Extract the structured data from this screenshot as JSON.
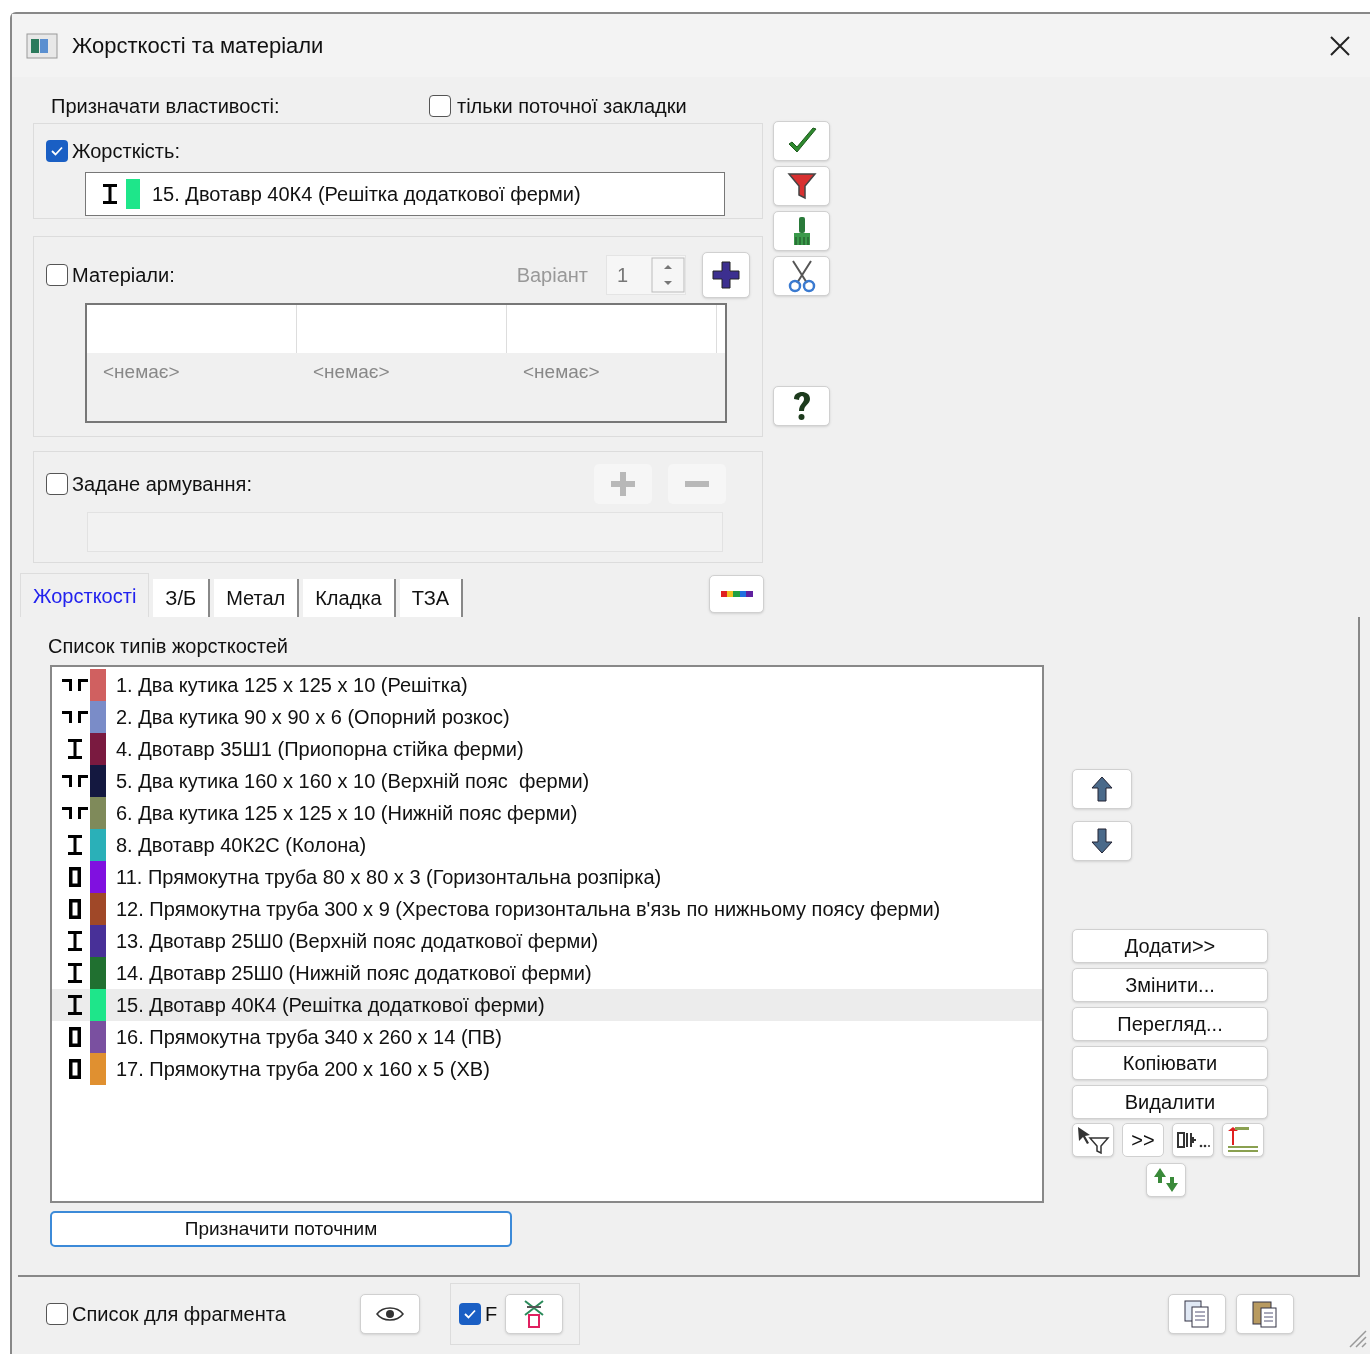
{
  "window": {
    "title": "Жорсткості та матеріали"
  },
  "assign": {
    "label": "Призначати властивості:",
    "current_tab_only": {
      "label": "тільки поточної закладки",
      "checked": false
    }
  },
  "stiffness": {
    "label": "Жорсткість:",
    "checked": true,
    "value": {
      "kind": "ibeam",
      "color": "#1ee68a",
      "text": "15. Двотавр 40К4 (Решітка додаткової ферми)"
    }
  },
  "materials": {
    "label": "Матеріали:",
    "checked": false,
    "variant_label": "Варіант",
    "variant": "1",
    "columns": [
      "<немає>",
      "<немає>",
      "<немає>"
    ]
  },
  "reinforcement": {
    "label": "Задане армування:",
    "checked": false
  },
  "tabs": [
    {
      "label": "Жорсткості",
      "selected": true
    },
    {
      "label": "З/Б",
      "selected": false
    },
    {
      "label": "Метал",
      "selected": false
    },
    {
      "label": "Кладка",
      "selected": false
    },
    {
      "label": "ТЗА",
      "selected": false
    }
  ],
  "list": {
    "title": "Список типів жорсткостей",
    "items": [
      {
        "kind": "angles",
        "color": "#d06060",
        "text": "1. Два кутика 125 х 125 х 10 (Решітка)",
        "selected": false
      },
      {
        "kind": "angles",
        "color": "#7a8cc8",
        "text": "2. Два кутика 90 х 90 х 6 (Опорний розкос)",
        "selected": false
      },
      {
        "kind": "ibeam",
        "color": "#7a1a40",
        "text": "4. Двотавр 35Ш1 (Приопорна стійка ферми)",
        "selected": false
      },
      {
        "kind": "angles",
        "color": "#141840",
        "text": "5. Два кутика 160 х 160 х 10 (Верхній пояс  ферми)",
        "selected": false
      },
      {
        "kind": "angles",
        "color": "#7f8a5a",
        "text": "6. Два кутика 125 х 125 х 10 (Нижній пояс ферми)",
        "selected": false
      },
      {
        "kind": "ibeam",
        "color": "#2ab0b8",
        "text": "8. Двотавр 40К2С (Колона)",
        "selected": false
      },
      {
        "kind": "tube",
        "color": "#8010e0",
        "text": "11. Прямокутна труба 80 х 80 х 3 (Горизонтальна розпірка)",
        "selected": false
      },
      {
        "kind": "tube",
        "color": "#a04828",
        "text": "12. Прямокутна труба 300 х 9 (Хрестова горизонтальна в'язь по нижньому поясу ферми)",
        "selected": false
      },
      {
        "kind": "ibeam",
        "color": "#483098",
        "text": "13. Двотавр 25Ш0 (Верхній пояс додаткової ферми)",
        "selected": false
      },
      {
        "kind": "ibeam",
        "color": "#207030",
        "text": "14. Двотавр 25Ш0 (Нижній пояс додаткової ферми)",
        "selected": false
      },
      {
        "kind": "ibeam",
        "color": "#1ee68a",
        "text": "15. Двотавр 40К4 (Решітка додаткової ферми)",
        "selected": true
      },
      {
        "kind": "tube",
        "color": "#7a50a0",
        "text": "16. Прямокутна труба 340 х 260 х 14 (ПВ)",
        "selected": false
      },
      {
        "kind": "tube",
        "color": "#e09030",
        "text": "17. Прямокутна труба 200 х 160 х 5 (ХВ)",
        "selected": false
      }
    ]
  },
  "side_buttons": [
    "Додати>>",
    "Змінити...",
    "Перегляд...",
    "Копіювати",
    "Видалити"
  ],
  "more_button": ">>",
  "assign_current": "Призначити поточним",
  "footer": {
    "fragment_list": {
      "label": "Список для фрагмента",
      "checked": false
    },
    "filter": {
      "label": "F",
      "checked": true
    }
  }
}
